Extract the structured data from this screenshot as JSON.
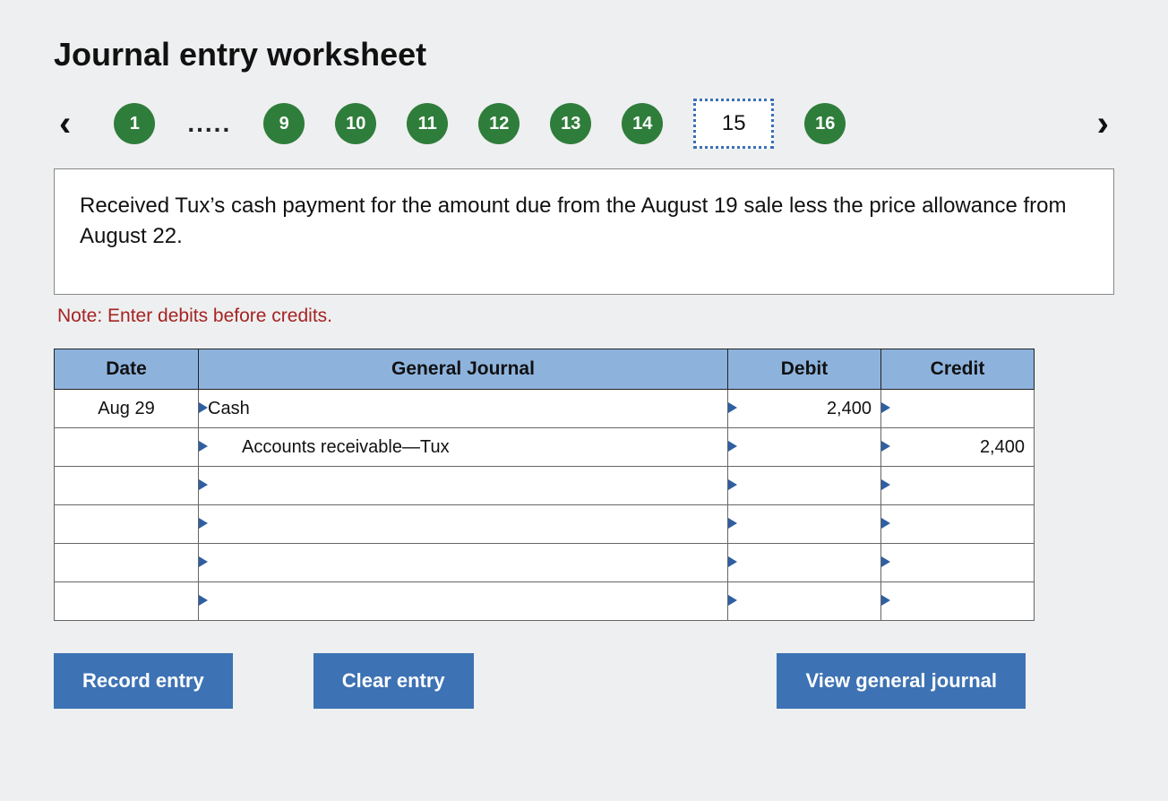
{
  "title": "Journal entry worksheet",
  "stepper": {
    "prev_icon": "chevron-left",
    "next_icon": "chevron-right",
    "items": [
      {
        "label": "1",
        "kind": "badge"
      },
      {
        "label": ".....",
        "kind": "ellipsis"
      },
      {
        "label": "9",
        "kind": "badge"
      },
      {
        "label": "10",
        "kind": "badge"
      },
      {
        "label": "11",
        "kind": "badge"
      },
      {
        "label": "12",
        "kind": "badge"
      },
      {
        "label": "13",
        "kind": "badge"
      },
      {
        "label": "14",
        "kind": "badge"
      },
      {
        "label": "15",
        "kind": "current"
      },
      {
        "label": "16",
        "kind": "badge"
      }
    ]
  },
  "description": "Received Tux’s cash payment for the amount due from the August 19 sale less the price allowance from August 22.",
  "note": "Note: Enter debits before credits.",
  "table": {
    "headers": {
      "date": "Date",
      "gj": "General Journal",
      "debit": "Debit",
      "credit": "Credit"
    },
    "rows": [
      {
        "date": "Aug 29",
        "account": "Cash",
        "indent": false,
        "debit": "2,400",
        "credit": ""
      },
      {
        "date": "",
        "account": "Accounts receivable—Tux",
        "indent": true,
        "debit": "",
        "credit": "2,400"
      },
      {
        "date": "",
        "account": "",
        "indent": false,
        "debit": "",
        "credit": ""
      },
      {
        "date": "",
        "account": "",
        "indent": false,
        "debit": "",
        "credit": ""
      },
      {
        "date": "",
        "account": "",
        "indent": false,
        "debit": "",
        "credit": ""
      },
      {
        "date": "",
        "account": "",
        "indent": false,
        "debit": "",
        "credit": ""
      }
    ]
  },
  "buttons": {
    "record": "Record entry",
    "clear": "Clear entry",
    "view": "View general journal"
  }
}
